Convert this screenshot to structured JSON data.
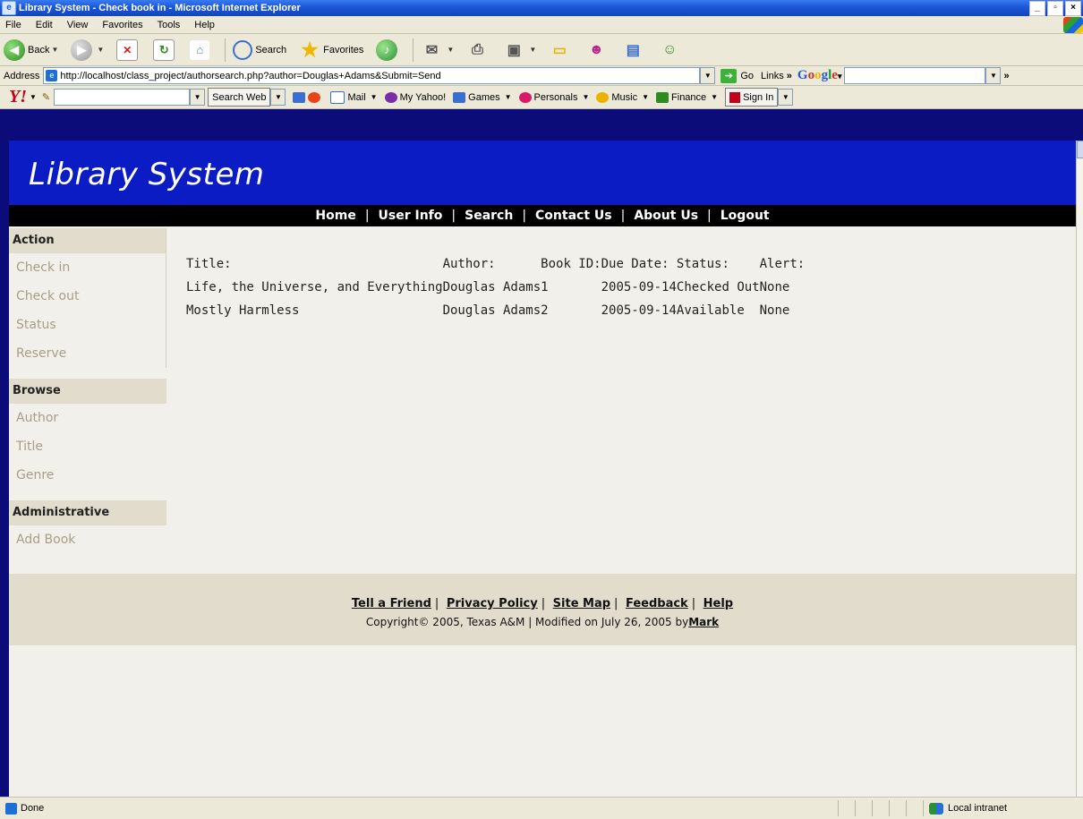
{
  "window": {
    "title": "Library System - Check book in - Microsoft Internet Explorer"
  },
  "menubar": {
    "items": [
      "File",
      "Edit",
      "View",
      "Favorites",
      "Tools",
      "Help"
    ]
  },
  "toolbar": {
    "back_label": "Back",
    "search_label": "Search",
    "favorites_label": "Favorites"
  },
  "addressbar": {
    "label": "Address",
    "url": "http://localhost/class_project/authorsearch.php?author=Douglas+Adams&Submit=Send",
    "go_label": "Go",
    "links_label": "Links",
    "links_chevron": "»",
    "google_logo": "Google"
  },
  "yahoobar": {
    "logo": "Y!",
    "search_button": "Search Web",
    "items": [
      "Mail",
      "My Yahoo!",
      "Games",
      "Personals",
      "Music",
      "Finance"
    ],
    "sign_in": "Sign In"
  },
  "page": {
    "site_title": "Library System",
    "nav": [
      "Home",
      "User Info",
      "Search",
      "Contact Us",
      "About Us",
      "Logout"
    ],
    "sidebar": {
      "action": {
        "heading": "Action",
        "items": [
          "Check in",
          "Check out",
          "Status",
          "Reserve"
        ]
      },
      "browse": {
        "heading": "Browse",
        "items": [
          "Author",
          "Title",
          "Genre"
        ]
      },
      "admin": {
        "heading": "Administrative",
        "items": [
          "Add Book"
        ]
      }
    },
    "results": {
      "headers": [
        "Title:",
        "Author:",
        "Book ID:",
        "Due Date:",
        "Status:",
        "Alert:"
      ],
      "rows": [
        [
          "Life, the Universe, and Everything",
          "Douglas Adams",
          "1",
          "2005-09-14",
          "Checked Out",
          "None"
        ],
        [
          "Mostly Harmless",
          "Douglas Adams",
          "2",
          "2005-09-14",
          "Available",
          "None"
        ]
      ]
    },
    "footer": {
      "links": [
        "Tell a Friend",
        "Privacy Policy",
        "Site Map",
        "Feedback",
        "Help"
      ],
      "copyright_prefix": "Copyright© 2005, Texas A&M | Modified on July 26, 2005 by",
      "author_link": "Mark"
    }
  },
  "statusbar": {
    "status": "Done",
    "zone": "Local intranet"
  }
}
